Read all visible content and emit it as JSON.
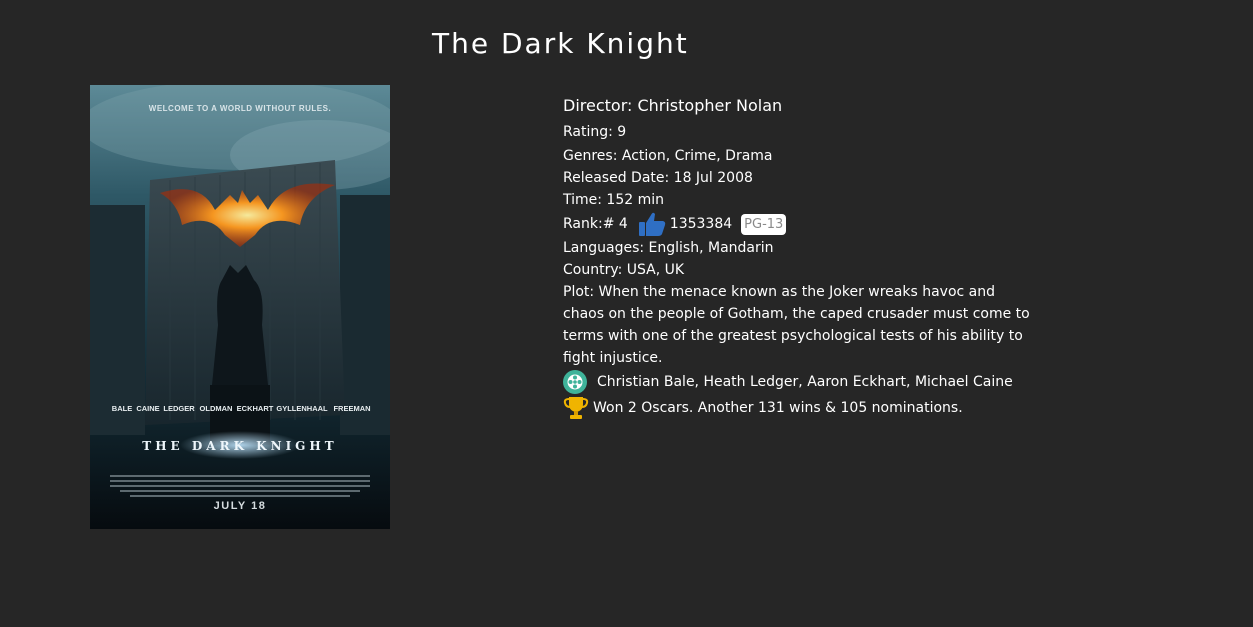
{
  "movie": {
    "title": "The Dark Knight",
    "director": "Director: Christopher Nolan",
    "rating": "Rating: 9",
    "genres": "Genres: Action, Crime, Drama",
    "released": "Released Date: 18 Jul 2008",
    "time": "Time: 152 min",
    "rank": "Rank:# 4",
    "votes": "1353384",
    "mpaa": "PG-13",
    "languages": "Languages: English, Mandarin",
    "country": "Country: USA, UK",
    "plot": "Plot: When the menace known as the Joker wreaks havoc and chaos on the people of Gotham, the caped crusader must come to terms with one of the greatest psychological tests of his ability to fight injustice.",
    "cast": "Christian Bale, Heath Ledger, Aaron Eckhart, Michael Caine",
    "awards": "Won 2 Oscars. Another 131 wins & 105 nominations."
  },
  "poster": {
    "tagline": "WELCOME TO A WORLD WITHOUT RULES.",
    "cast_names": [
      "BALE",
      "CAINE",
      "LEDGER",
      "OLDMAN",
      "ECKHART",
      "GYLLENHAAL",
      "FREEMAN"
    ],
    "logo_text": "THE DARK KNIGHT",
    "release": "JULY 18"
  },
  "icons": {
    "thumbs": "thumbs-up-icon",
    "reel": "film-reel-icon",
    "trophy": "trophy-icon"
  },
  "colors": {
    "background": "#262626",
    "thumb": "#2f6fc4",
    "reel": "#3fb39a",
    "trophy": "#f0b400"
  }
}
